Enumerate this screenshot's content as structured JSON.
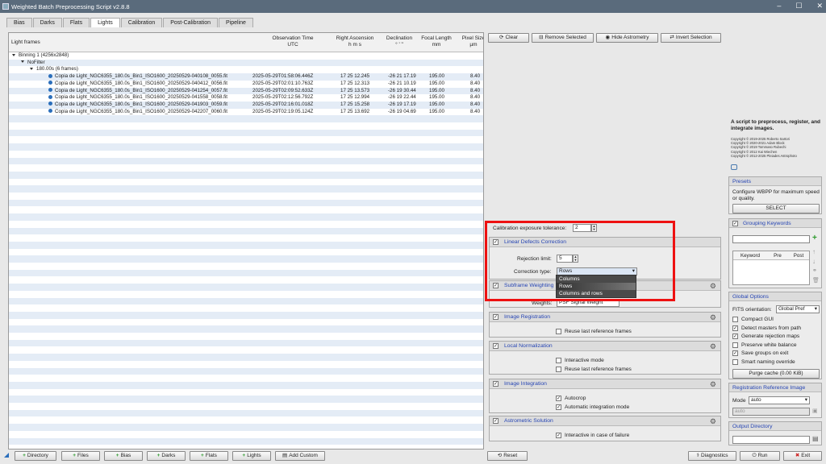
{
  "window": {
    "title": "Weighted Batch Preprocessing Script v2.8.8"
  },
  "tabs": [
    "Bias",
    "Darks",
    "Flats",
    "Lights",
    "Calibration",
    "Post-Calibration",
    "Pipeline"
  ],
  "table": {
    "headers": [
      {
        "l1": "Light frames",
        "l2": ""
      },
      {
        "l1": "Observation Time",
        "l2": "UTC"
      },
      {
        "l1": "Right Ascension",
        "l2": "h   m   s"
      },
      {
        "l1": "Declination",
        "l2": "°   '   \""
      },
      {
        "l1": "Focal Length",
        "l2": "mm"
      },
      {
        "l1": "Pixel Size",
        "l2": "µm"
      }
    ],
    "group1": "Binning 1 (4256x2848)",
    "group2": "NoFilter",
    "group3": "180.00s (6 frames)",
    "rows": [
      {
        "file": "Copia de Light_NGC6355_180.0s_Bin1_ISO1600_20250529-040108_0055.fit",
        "time": "2025-05-29T01:58:06.446Z",
        "ra": "17 25 12.245",
        "dec": "-26 21 17.19",
        "fl": "195.00",
        "px": "8.40"
      },
      {
        "file": "Copia de Light_NGC6355_180.0s_Bin1_ISO1600_20250529-040412_0056.fit",
        "time": "2025-05-29T02:01:10.763Z",
        "ra": "17 25 12.313",
        "dec": "-26 21 10.19",
        "fl": "195.00",
        "px": "8.40"
      },
      {
        "file": "Copia de Light_NGC6355_180.0s_Bin1_ISO1600_20250529-041254_0057.fit",
        "time": "2025-05-29T02:09:52.633Z",
        "ra": "17 25 13.573",
        "dec": "-26 19 30.44",
        "fl": "195.00",
        "px": "8.40"
      },
      {
        "file": "Copia de Light_NGC6355_180.0s_Bin1_ISO1600_20250529-041558_0058.fit",
        "time": "2025-05-29T02:12:56.792Z",
        "ra": "17 25 12.994",
        "dec": "-26 19 22.44",
        "fl": "195.00",
        "px": "8.40"
      },
      {
        "file": "Copia de Light_NGC6355_180.0s_Bin1_ISO1600_20250529-041903_0059.fit",
        "time": "2025-05-29T02:16:01.018Z",
        "ra": "17 25 15.258",
        "dec": "-26 19 17.19",
        "fl": "195.00",
        "px": "8.40"
      },
      {
        "file": "Copia de Light_NGC6355_180.0s_Bin1_ISO1600_20250529-042207_0060.fit",
        "time": "2025-05-29T02:19:05.124Z",
        "ra": "17 25 13.692",
        "dec": "-26 19 04.69",
        "fl": "195.00",
        "px": "8.40"
      }
    ]
  },
  "toolbar": {
    "clear": "Clear",
    "remove": "Remove Selected",
    "hide": "Hide Astrometry",
    "invert": "Invert Selection"
  },
  "calib": {
    "label": "Calibration exposure tolerance:",
    "value": "2"
  },
  "linear": {
    "title": "Linear Defects Correction",
    "rej_label": "Rejection limit:",
    "rej_value": "5",
    "type_label": "Correction type:",
    "type_value": "Rows",
    "options": [
      "Columns",
      "Rows",
      "Columns and rows"
    ]
  },
  "subframe": {
    "title": "Subframe Weighting",
    "weights_label": "Weights:",
    "weights_value": "PSF Signal Weight"
  },
  "registration": {
    "title": "Image Registration",
    "reuse": "Reuse last reference frames"
  },
  "localnorm": {
    "title": "Local Normalization",
    "interactive": "Interactive mode",
    "reuse": "Reuse last reference frames"
  },
  "integration": {
    "title": "Image Integration",
    "autocrop": "Autocrop",
    "auto": "Automatic integration mode"
  },
  "astrometric": {
    "title": "Astrometric Solution",
    "interactive": "Interactive in case of failure"
  },
  "about": {
    "text": "A script to preprocess, register, and integrate images.",
    "credits": [
      "Copyright © 2019-2025 Roberto Sartori",
      "Copyright © 2020-2021 Adam Block",
      "Copyright © 2019 Tommaso Rubechi",
      "Copyright © 2012 Kai Wiechen",
      "Copyright © 2012-2025 Pleiades Astrophoto"
    ]
  },
  "presets": {
    "title": "Presets",
    "text": "Configure WBPP for maximum speed or quality.",
    "select": "SELECT"
  },
  "grouping": {
    "title": "Grouping Keywords",
    "cols": [
      "Keyword",
      "Pre",
      "Post"
    ]
  },
  "global": {
    "title": "Global Options",
    "fits_label": "FITS orientation:",
    "fits_value": "Global Pref",
    "opts": [
      {
        "l": "Compact GUI",
        "c": false
      },
      {
        "l": "Detect masters from path",
        "c": true
      },
      {
        "l": "Generate rejection maps",
        "c": true
      },
      {
        "l": "Preserve white balance",
        "c": false
      },
      {
        "l": "Save groups on exit",
        "c": true
      },
      {
        "l": "Smart naming override",
        "c": false
      }
    ],
    "purge": "Purge cache (0.00 KiB)"
  },
  "regref": {
    "title": "Registration Reference Image",
    "mode_label": "Mode",
    "mode_value": "auto",
    "field": "auto"
  },
  "output": {
    "title": "Output Directory"
  },
  "bottom": {
    "directory": "Directory",
    "files": "Files",
    "bias": "Bias",
    "darks": "Darks",
    "flats": "Flats",
    "lights": "Lights",
    "custom": "Add Custom",
    "reset": "Reset",
    "diagnostics": "Diagnostics",
    "run": "Run",
    "exit": "Exit"
  }
}
